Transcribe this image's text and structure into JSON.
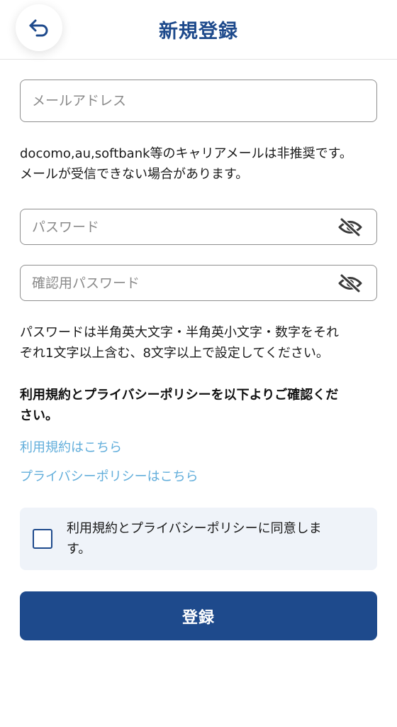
{
  "header": {
    "title": "新規登録",
    "back_icon": "back-arrow-icon"
  },
  "form": {
    "email_placeholder": "メールアドレス",
    "email_value": "",
    "email_note_line1": "docomo,au,softbank等のキャリアメールは非推奨です。",
    "email_note_line2": "メールが受信できない場合があります。",
    "password_placeholder": "パスワード",
    "password_value": "",
    "confirm_password_placeholder": "確認用パスワード",
    "confirm_password_value": "",
    "visibility_icon": "eye-off-icon",
    "password_note_line1": "パスワードは半角英大文字・半角英小文字・数字をそれ",
    "password_note_line2": "ぞれ1文字以上含む、8文字以上で設定してください。"
  },
  "terms": {
    "heading_line1": "利用規約とプライバシーポリシーを以下よりご確認くだ",
    "heading_line2": "さい。",
    "terms_link": "利用規約はこちら",
    "privacy_link": "プライバシーポリシーはこちら",
    "agree_label_line1": "利用規約とプライバシーポリシーに同意しま",
    "agree_label_line2": "す。",
    "agree_checked": false
  },
  "submit_label": "登録",
  "colors": {
    "primary": "#1e4a8c",
    "link": "#62aedb",
    "agree_bg": "#eff3f9",
    "border": "#8f8f8f"
  }
}
